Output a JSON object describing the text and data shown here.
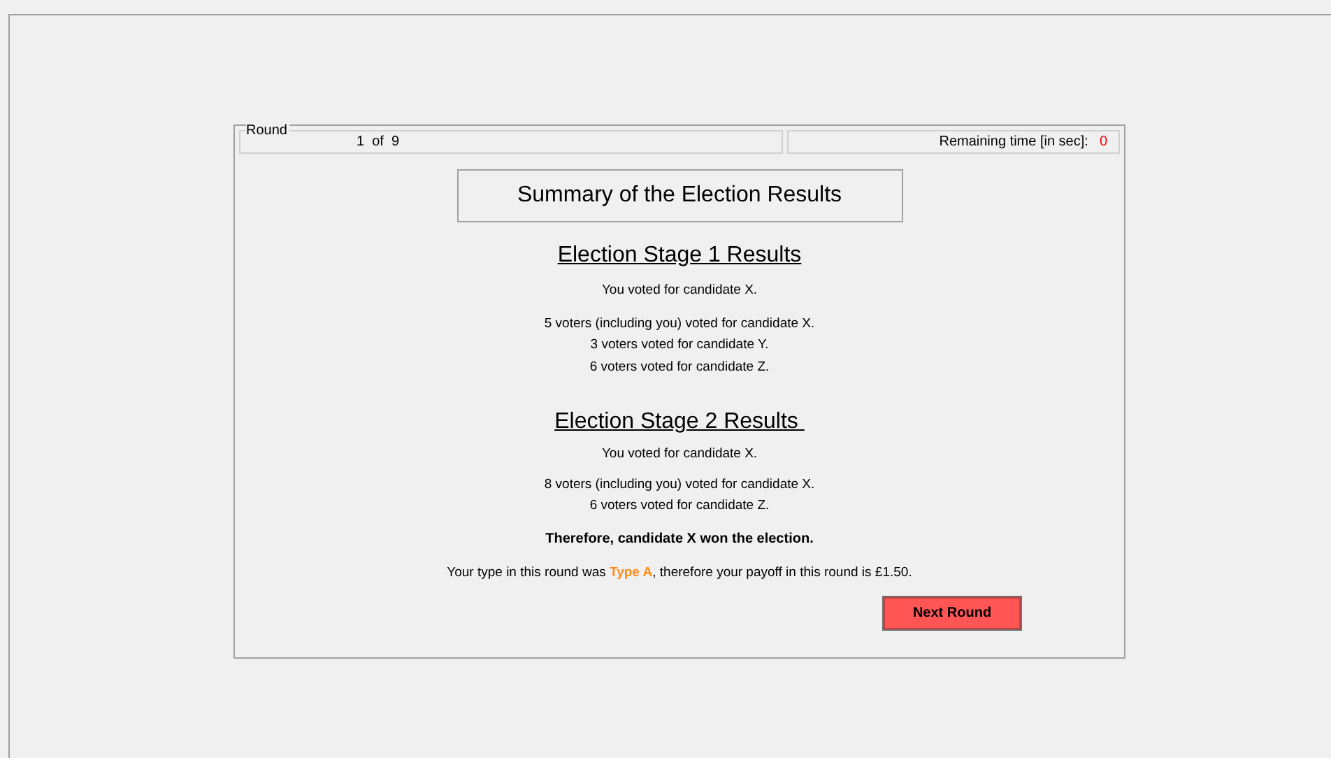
{
  "round": {
    "label": "Round",
    "current": "1",
    "of": "of",
    "total": "9"
  },
  "timer": {
    "label": "Remaining time [in sec]:",
    "value": "0"
  },
  "title": "Summary of the Election Results",
  "stages": [
    {
      "heading": "Election Stage 1 Results",
      "own_vote": "You voted for candidate X.",
      "tallies": [
        "5 voters (including you) voted for candidate X.",
        "3 voters voted for candidate Y.",
        "6 voters voted for candidate Z."
      ]
    },
    {
      "heading": "Election Stage 2 Results ",
      "own_vote": "You voted for candidate X.",
      "tallies": [
        "8 voters (including you) voted for candidate X.",
        "6 voters voted for candidate Z."
      ]
    }
  ],
  "conclusion": "Therefore, candidate X won the election.",
  "payoff": {
    "before": "Your type in this round was ",
    "type": "Type A",
    "after": ", therefore your payoff in this round is £1.50."
  },
  "button": "Next Round"
}
